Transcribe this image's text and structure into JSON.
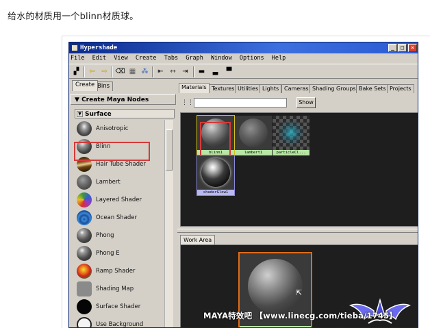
{
  "caption": "给水的材质用一个blinn材质球。",
  "window": {
    "title": "Hypershade",
    "controls": [
      "_",
      "□",
      "×"
    ]
  },
  "menu": [
    "File",
    "Edit",
    "View",
    "Create",
    "Tabs",
    "Graph",
    "Window",
    "Options",
    "Help"
  ],
  "left": {
    "tabs": [
      "Create",
      "Bins"
    ],
    "create_header": "Create Maya Nodes",
    "section": "Surface",
    "nodes": [
      {
        "label": "Anisotropic",
        "icon": "anisotropic-swatch"
      },
      {
        "label": "Blinn",
        "icon": "blinn-swatch"
      },
      {
        "label": "Hair Tube Shader",
        "icon": "hair-tube-swatch"
      },
      {
        "label": "Lambert",
        "icon": "lambert-swatch"
      },
      {
        "label": "Layered Shader",
        "icon": "layered-swatch"
      },
      {
        "label": "Ocean Shader",
        "icon": "ocean-swatch"
      },
      {
        "label": "Phong",
        "icon": "phong-swatch"
      },
      {
        "label": "Phong E",
        "icon": "phong-e-swatch"
      },
      {
        "label": "Ramp Shader",
        "icon": "ramp-swatch"
      },
      {
        "label": "Shading Map",
        "icon": "shading-map-swatch"
      },
      {
        "label": "Surface Shader",
        "icon": "surface-shader-swatch"
      },
      {
        "label": "Use Background",
        "icon": "use-background-swatch"
      }
    ]
  },
  "right": {
    "tabs": [
      "Materials",
      "Textures",
      "Utilities",
      "Lights",
      "Cameras",
      "Shading Groups",
      "Bake Sets",
      "Projects"
    ],
    "show_label": "Show",
    "materials": [
      {
        "name": "blinn1"
      },
      {
        "name": "lambert1"
      },
      {
        "name": "particleCl..."
      },
      {
        "name": "shaderGlow1"
      }
    ],
    "work_area_tab": "Work Area"
  },
  "watermark": "MAYA特效吧 【www.linecg.com/tieba/1745】",
  "colors": {
    "highlight_red": "#d43a3a",
    "selected_orange": "#e06b18",
    "blinn_label": "#b7e6a5",
    "glow_label": "#b9b9f0"
  }
}
